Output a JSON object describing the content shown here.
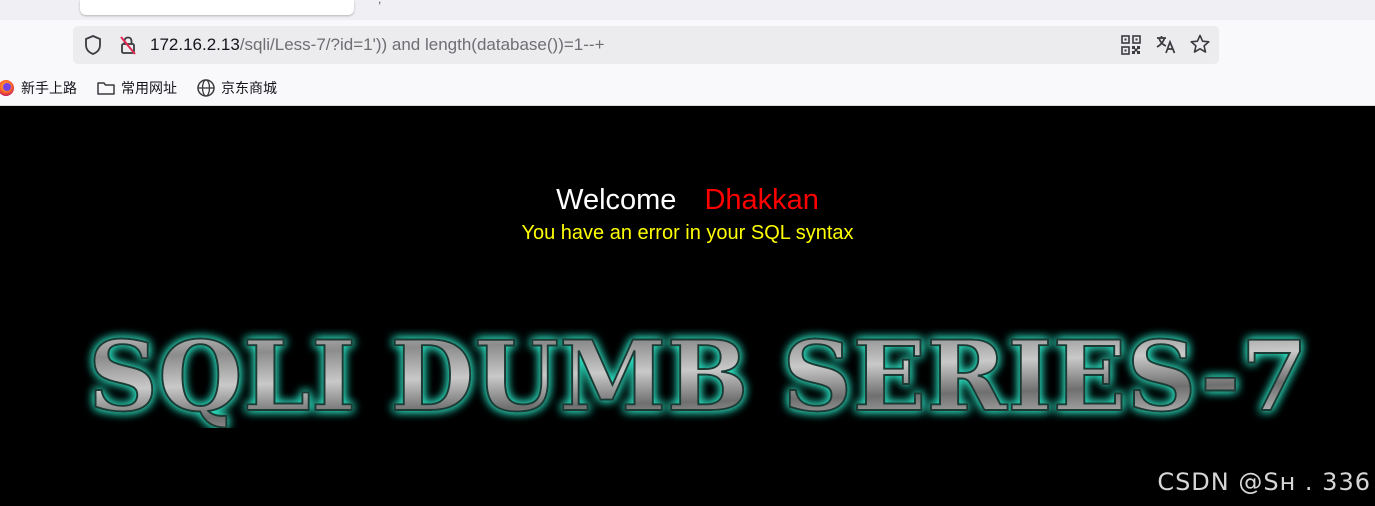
{
  "browser": {
    "tab_fragment": ",",
    "url_host": "172.16.2.13",
    "url_path": "/sqli/Less-7/?id=1')) and length(database())=1--+",
    "bookmarks": [
      "新手上路",
      "常用网址",
      "京东商城"
    ]
  },
  "page": {
    "welcome_label": "Welcome",
    "welcome_name": "Dhakkan",
    "error_message": "You have an error in your SQL syntax",
    "banner_text": "SQLI DUMB SERIES-7",
    "watermark": "CSDN @Sʜ    . 336"
  },
  "colors": {
    "welcome": "#ffffff",
    "name": "#ff0000",
    "error": "#ffff00",
    "banner_glow": "#2ee8c8"
  },
  "icons": [
    "shield-icon",
    "insecure-lock-icon",
    "qr-code-icon",
    "translate-icon",
    "bookmark-star-icon",
    "firefox-icon",
    "folder-icon",
    "globe-icon"
  ]
}
